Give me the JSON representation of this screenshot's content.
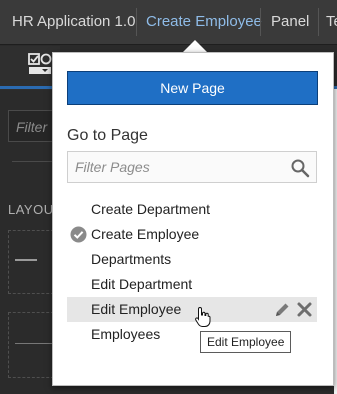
{
  "header": {
    "breadcrumbs": [
      "HR Application 1.0",
      "Create Employee",
      "Panel",
      "Te"
    ]
  },
  "sidebar": {
    "filter_placeholder": "Filter",
    "section_label": "LAYOU"
  },
  "popup": {
    "new_page_label": "New Page",
    "goto_title": "Go to Page",
    "filter_placeholder": "Filter Pages",
    "pages": [
      {
        "label": "Create Department"
      },
      {
        "label": "Create Employee",
        "current": true
      },
      {
        "label": "Departments"
      },
      {
        "label": "Edit Department"
      },
      {
        "label": "Edit Employee",
        "hovered": true
      },
      {
        "label": "Employees"
      }
    ],
    "tooltip": "Edit Employee"
  },
  "right_fragments": [
    "Re",
    "Te"
  ],
  "colors": {
    "accent": "#1f6fc5",
    "active_crumb": "#8fbce8",
    "dark_bg": "#2b2b2b",
    "header_bg": "#3a3a3a"
  },
  "icons": [
    "checkbox-tool-icon",
    "search-icon",
    "check-circle-icon",
    "pencil-icon",
    "close-icon",
    "hand-cursor-icon"
  ]
}
